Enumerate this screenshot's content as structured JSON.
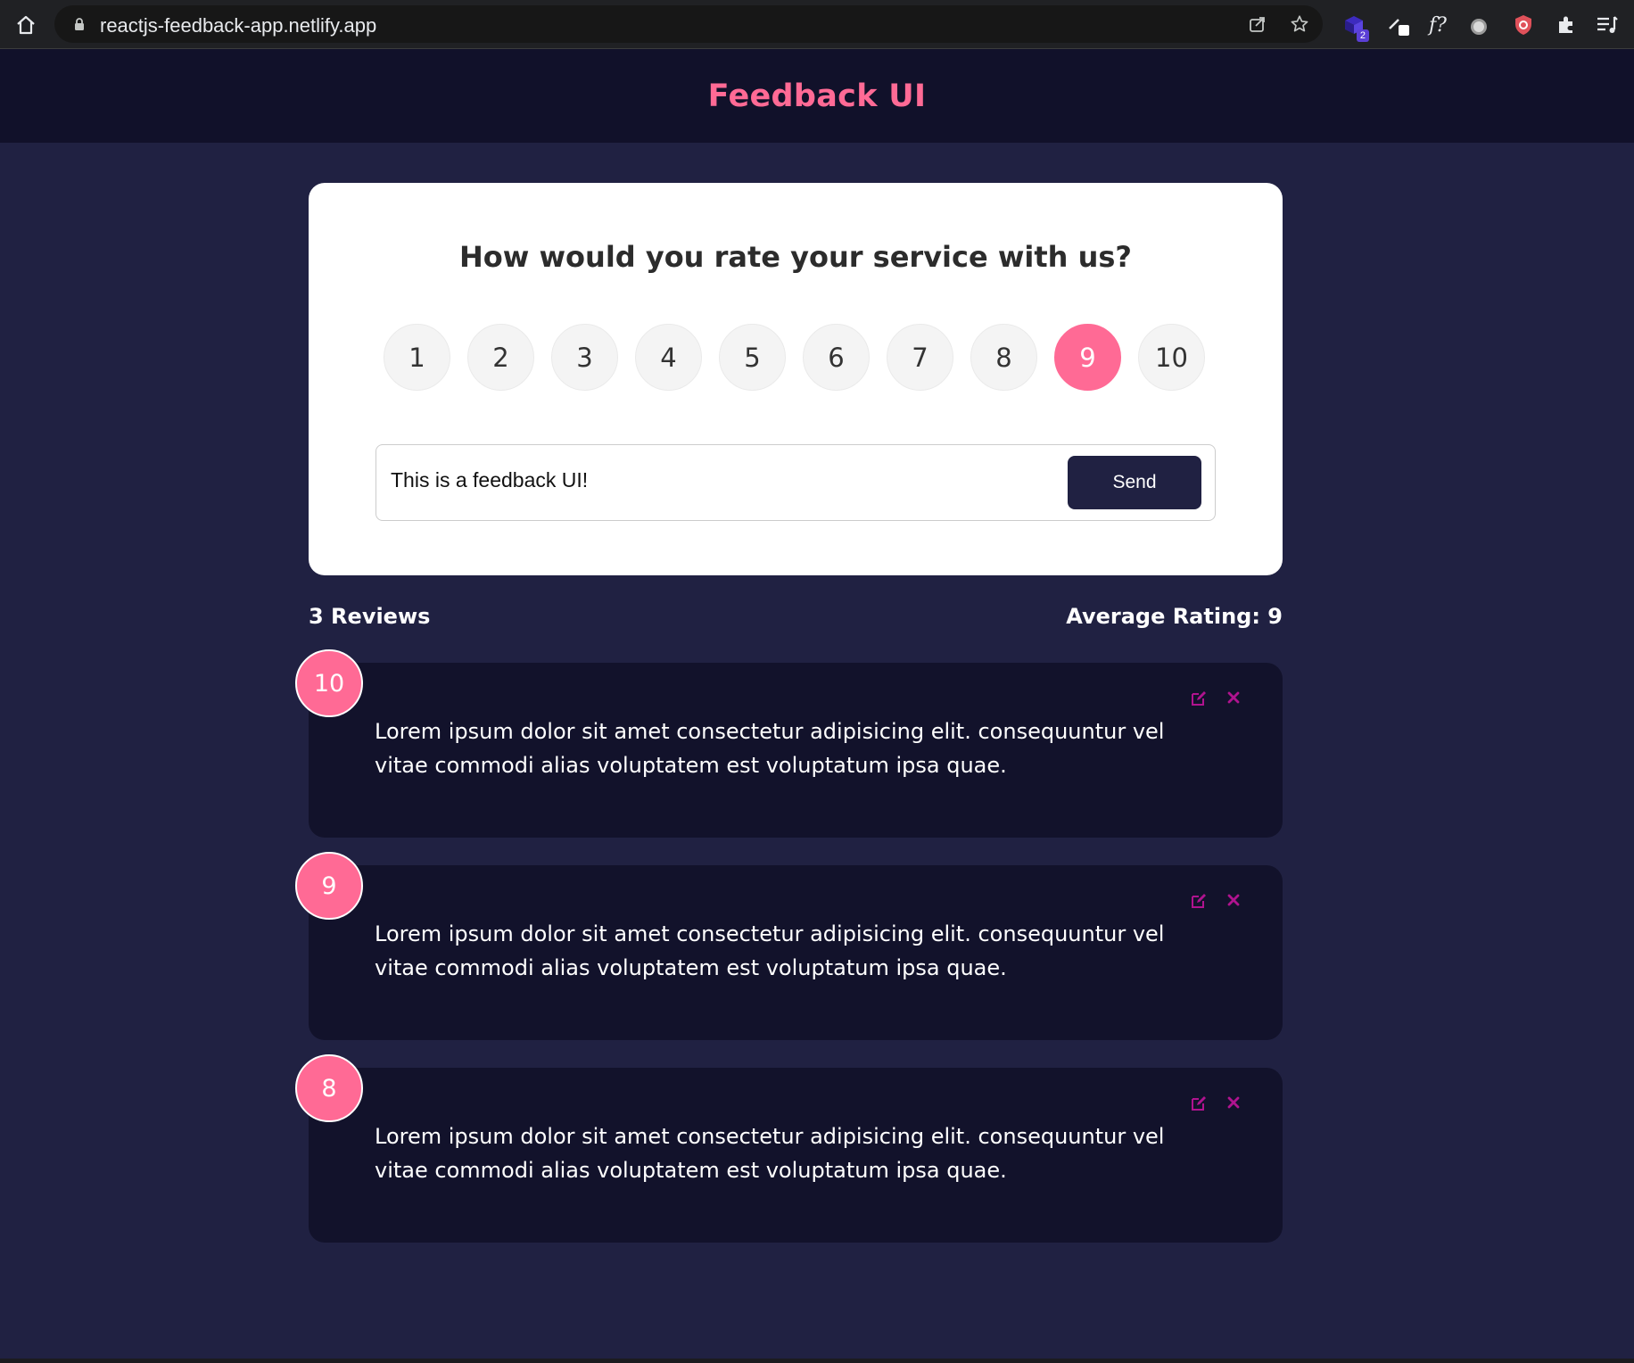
{
  "browser": {
    "url": "reactjs-feedback-app.netlify.app",
    "extension_badge": "2",
    "extension_f_label": "f?"
  },
  "header": {
    "title": "Feedback UI"
  },
  "rating_card": {
    "heading": "How would you rate your service with us?",
    "options": [
      "1",
      "2",
      "3",
      "4",
      "5",
      "6",
      "7",
      "8",
      "9",
      "10"
    ],
    "selected": "9",
    "input_value": "This is a feedback UI!",
    "send_label": "Send"
  },
  "stats": {
    "count_label": "3 Reviews",
    "average_label": "Average Rating: 9"
  },
  "reviews": [
    {
      "rating": "10",
      "text": "Lorem ipsum dolor sit amet consectetur adipisicing elit. consequuntur vel vitae commodi alias voluptatem est voluptatum ipsa quae."
    },
    {
      "rating": "9",
      "text": "Lorem ipsum dolor sit amet consectetur adipisicing elit. consequuntur vel vitae commodi alias voluptatem est voluptatum ipsa quae."
    },
    {
      "rating": "8",
      "text": "Lorem ipsum dolor sit amet consectetur adipisicing elit. consequuntur vel vitae commodi alias voluptatem est voluptatum ipsa quae."
    }
  ],
  "colors": {
    "accent": "#ff6a95",
    "background": "#202142",
    "header_bg": "#11112a",
    "card_dark": "#12122b",
    "icon_purple": "#b0138f"
  }
}
